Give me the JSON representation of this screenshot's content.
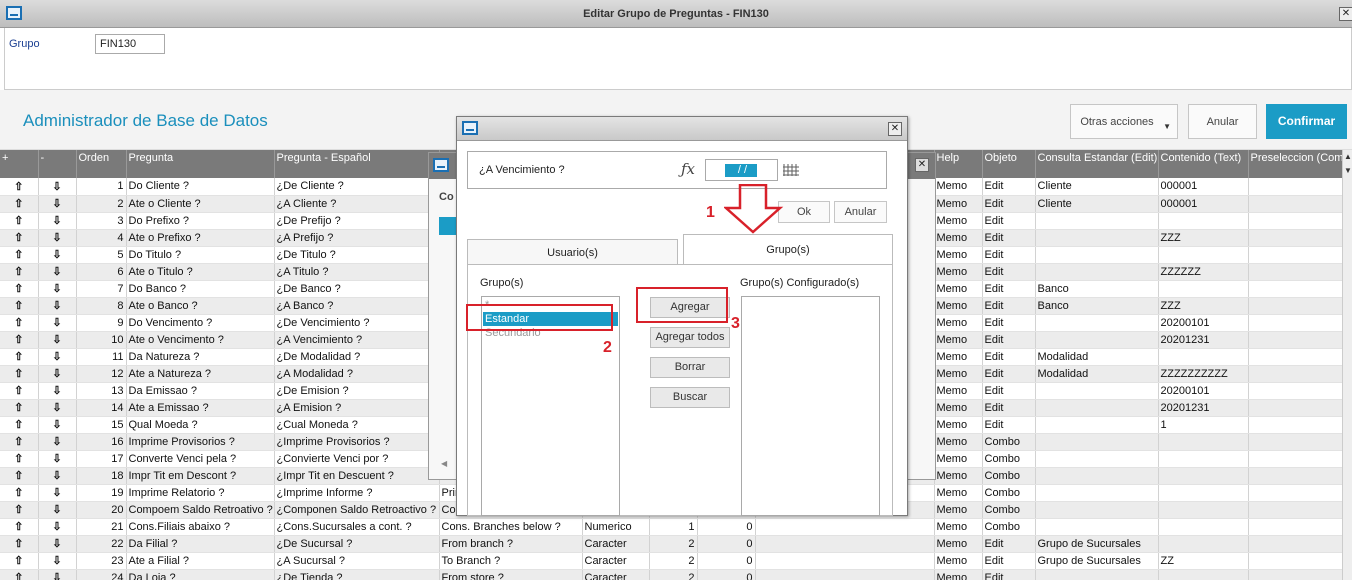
{
  "window": {
    "title": "Editar Grupo de Preguntas - FIN130"
  },
  "header": {
    "grupo_label": "Grupo",
    "grupo_value": "FIN130"
  },
  "toolbar": {
    "title": "Administrador de Base de Datos",
    "otras_label": "Otras acciones",
    "anular_label": "Anular",
    "confirmar_label": "Confirmar"
  },
  "grid": {
    "columns": [
      "+",
      "-",
      "Orden",
      "Pregunta",
      "Pregunta - Español",
      "",
      "",
      "",
      "",
      "",
      "Help",
      "Objeto",
      "Consulta Estandar (Edit)",
      "Contenido (Text)",
      "Preseleccion (Com"
    ],
    "rows": [
      {
        "orden": "1",
        "pregunta": "Do Cliente ?",
        "esp": "¿De Cliente ?",
        "eng": "",
        "tipo": "",
        "tam": "",
        "dec": "",
        "help": "Memo",
        "obj": "Edit",
        "cons": "Cliente",
        "cont": "000001"
      },
      {
        "orden": "2",
        "pregunta": "Ate o Cliente ?",
        "esp": "¿A Cliente ?",
        "eng": "",
        "tipo": "",
        "tam": "",
        "dec": "",
        "help": "Memo",
        "obj": "Edit",
        "cons": "Cliente",
        "cont": "000001"
      },
      {
        "orden": "3",
        "pregunta": "Do Prefixo ?",
        "esp": "¿De Prefijo ?",
        "eng": "",
        "tipo": "",
        "tam": "",
        "dec": "",
        "help": "Memo",
        "obj": "Edit",
        "cons": "",
        "cont": ""
      },
      {
        "orden": "4",
        "pregunta": "Ate o Prefixo ?",
        "esp": "¿A Prefijo ?",
        "eng": "",
        "tipo": "",
        "tam": "",
        "dec": "",
        "help": "Memo",
        "obj": "Edit",
        "cons": "",
        "cont": "ZZZ"
      },
      {
        "orden": "5",
        "pregunta": "Do Titulo ?",
        "esp": "¿De Titulo ?",
        "eng": "",
        "tipo": "",
        "tam": "",
        "dec": "",
        "help": "Memo",
        "obj": "Edit",
        "cons": "",
        "cont": ""
      },
      {
        "orden": "6",
        "pregunta": "Ate o Titulo ?",
        "esp": "¿A Titulo ?",
        "eng": "",
        "tipo": "",
        "tam": "",
        "dec": "",
        "help": "Memo",
        "obj": "Edit",
        "cons": "",
        "cont": "ZZZZZZ"
      },
      {
        "orden": "7",
        "pregunta": "Do Banco ?",
        "esp": "¿De Banco ?",
        "eng": "",
        "tipo": "",
        "tam": "",
        "dec": "",
        "help": "Memo",
        "obj": "Edit",
        "cons": "Banco",
        "cont": ""
      },
      {
        "orden": "8",
        "pregunta": "Ate o Banco ?",
        "esp": "¿A Banco ?",
        "eng": "",
        "tipo": "",
        "tam": "",
        "dec": "",
        "help": "Memo",
        "obj": "Edit",
        "cons": "Banco",
        "cont": "ZZZ"
      },
      {
        "orden": "9",
        "pregunta": "Do Vencimento ?",
        "esp": "¿De Vencimiento ?",
        "eng": "",
        "tipo": "",
        "tam": "",
        "dec": "",
        "help": "Memo",
        "obj": "Edit",
        "cons": "",
        "cont": "20200101"
      },
      {
        "orden": "10",
        "pregunta": "Ate o Vencimento ?",
        "esp": "¿A Vencimiento ?",
        "eng": "",
        "tipo": "",
        "tam": "",
        "dec": "",
        "help": "Memo",
        "obj": "Edit",
        "cons": "",
        "cont": "20201231"
      },
      {
        "orden": "11",
        "pregunta": "Da Natureza ?",
        "esp": "¿De Modalidad ?",
        "eng": "",
        "tipo": "",
        "tam": "",
        "dec": "",
        "help": "Memo",
        "obj": "Edit",
        "cons": "Modalidad",
        "cont": ""
      },
      {
        "orden": "12",
        "pregunta": "Ate a Natureza ?",
        "esp": "¿A Modalidad ?",
        "eng": "",
        "tipo": "",
        "tam": "",
        "dec": "",
        "help": "Memo",
        "obj": "Edit",
        "cons": "Modalidad",
        "cont": "ZZZZZZZZZZ"
      },
      {
        "orden": "13",
        "pregunta": "Da Emissao ?",
        "esp": "¿De Emision ?",
        "eng": "",
        "tipo": "",
        "tam": "",
        "dec": "",
        "help": "Memo",
        "obj": "Edit",
        "cons": "",
        "cont": "20200101"
      },
      {
        "orden": "14",
        "pregunta": "Ate a Emissao ?",
        "esp": "¿A Emision ?",
        "eng": "",
        "tipo": "",
        "tam": "",
        "dec": "",
        "help": "Memo",
        "obj": "Edit",
        "cons": "",
        "cont": "20201231"
      },
      {
        "orden": "15",
        "pregunta": "Qual Moeda ?",
        "esp": "¿Cual Moneda ?",
        "eng": "",
        "tipo": "",
        "tam": "",
        "dec": "",
        "help": "Memo",
        "obj": "Edit",
        "cons": "",
        "cont": "1"
      },
      {
        "orden": "16",
        "pregunta": "Imprime Provisorios ?",
        "esp": "¿Imprime Provisorios ?",
        "eng": "",
        "tipo": "",
        "tam": "",
        "dec": "",
        "help": "Memo",
        "obj": "Combo",
        "cons": "",
        "cont": ""
      },
      {
        "orden": "17",
        "pregunta": "Converte Venci pela ?",
        "esp": "¿Convierte Venci por ?",
        "eng": "",
        "tipo": "",
        "tam": "",
        "dec": "",
        "help": "Memo",
        "obj": "Combo",
        "cons": "",
        "cont": ""
      },
      {
        "orden": "18",
        "pregunta": "Impr Tit em Descont ?",
        "esp": "¿Impr Tit en Descuent ?",
        "eng": "",
        "tipo": "",
        "tam": "",
        "dec": "",
        "help": "Memo",
        "obj": "Combo",
        "cons": "",
        "cont": ""
      },
      {
        "orden": "19",
        "pregunta": "Imprime Relatorio ?",
        "esp": "¿Imprime Informe ?",
        "eng": "Prir",
        "tipo": "",
        "tam": "",
        "dec": "",
        "help": "Memo",
        "obj": "Combo",
        "cons": "",
        "cont": ""
      },
      {
        "orden": "20",
        "pregunta": "Compoem Saldo Retroativo ?",
        "esp": "¿Componen Saldo Retroactivo ?",
        "eng": "Cor",
        "tipo": "",
        "tam": "",
        "dec": "",
        "help": "Memo",
        "obj": "Combo",
        "cons": "",
        "cont": ""
      },
      {
        "orden": "21",
        "pregunta": "Cons.Filiais abaixo ?",
        "esp": "¿Cons.Sucursales a cont. ?",
        "eng": "Cons. Branches below ?",
        "tipo": "Numerico",
        "tam": "1",
        "dec": "0",
        "help": "Memo",
        "obj": "Combo",
        "cons": "",
        "cont": ""
      },
      {
        "orden": "22",
        "pregunta": "Da Filial ?",
        "esp": "¿De Sucursal ?",
        "eng": "From branch ?",
        "tipo": "Caracter",
        "tam": "2",
        "dec": "0",
        "help": "Memo",
        "obj": "Edit",
        "cons": "Grupo de Sucursales",
        "cont": ""
      },
      {
        "orden": "23",
        "pregunta": "Ate a Filial ?",
        "esp": "¿A Sucursal ?",
        "eng": "To Branch ?",
        "tipo": "Caracter",
        "tam": "2",
        "dec": "0",
        "help": "Memo",
        "obj": "Edit",
        "cons": "Grupo de Sucursales",
        "cont": "ZZ"
      },
      {
        "orden": "24",
        "pregunta": "Da Loja ?",
        "esp": "¿De Tienda ?",
        "eng": "From store ?",
        "tipo": "Caracter",
        "tam": "2",
        "dec": "0",
        "help": "Memo",
        "obj": "Edit",
        "cons": "",
        "cont": ""
      }
    ]
  },
  "back_window": {
    "col_label": "Co"
  },
  "dialog": {
    "question": "¿A Vencimiento ?",
    "value": " / /",
    "ok_label": "Ok",
    "anular_label": "Anular",
    "tabs": [
      "Usuario(s)",
      "Grupo(s)"
    ],
    "groups_label": "Grupo(s)",
    "configured_label": "Grupo(s) Configurado(s)",
    "groups": [
      "*",
      "Estandar",
      "Secundario"
    ],
    "buttons": {
      "agregar": "Agregar",
      "agregar_todos": "Agregar todos",
      "borrar": "Borrar",
      "buscar": "Buscar"
    }
  },
  "annotations": {
    "n1": "1",
    "n2": "2",
    "n3": "3",
    "color": "#d8212a"
  }
}
